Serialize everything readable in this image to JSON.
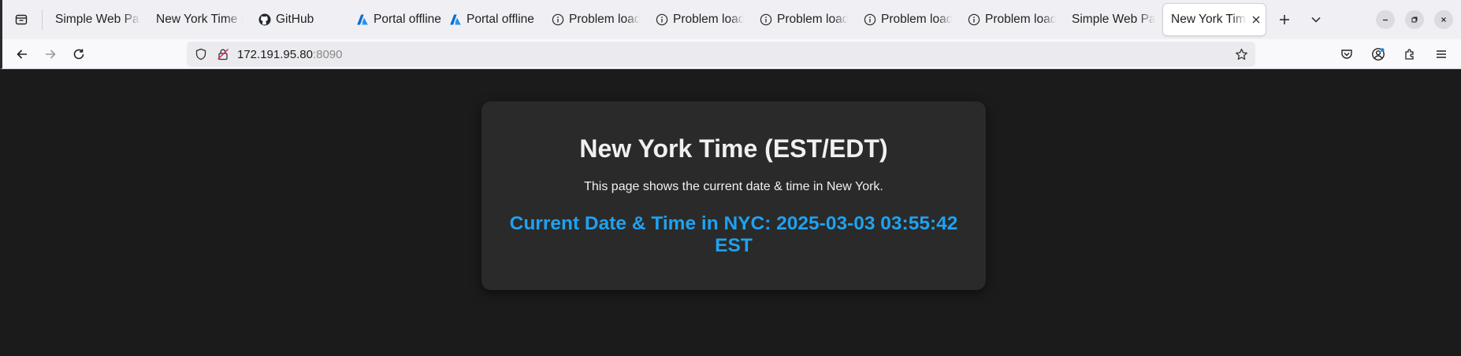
{
  "tabs": [
    {
      "label": "Simple Web Page",
      "icon": "none"
    },
    {
      "label": "New York Time Page",
      "icon": "none"
    },
    {
      "label": "GitHub",
      "icon": "github-icon"
    },
    {
      "label": "Portal offline",
      "icon": "azure-icon"
    },
    {
      "label": "Portal offline",
      "icon": "azure-icon"
    },
    {
      "label": "Problem loading page",
      "icon": "info-icon"
    },
    {
      "label": "Problem loading page",
      "icon": "info-icon"
    },
    {
      "label": "Problem loading page",
      "icon": "info-icon"
    },
    {
      "label": "Problem loading page",
      "icon": "info-icon"
    },
    {
      "label": "Problem loading page",
      "icon": "info-icon"
    },
    {
      "label": "Simple Web Page",
      "icon": "none"
    },
    {
      "label": "New York Time Page",
      "icon": "none",
      "active": true
    }
  ],
  "address": {
    "host": "172.191.95.80",
    "port": ":8090"
  },
  "page": {
    "heading": "New York Time (EST/EDT)",
    "description": "This page shows the current date & time in New York.",
    "time_line": "Current Date & Time in NYC: 2025-03-03 03:55:42 EST"
  },
  "colors": {
    "accent_time": "#1ea2f1",
    "page_bg": "#1c1b1c",
    "card_bg": "#2a2a2a"
  }
}
